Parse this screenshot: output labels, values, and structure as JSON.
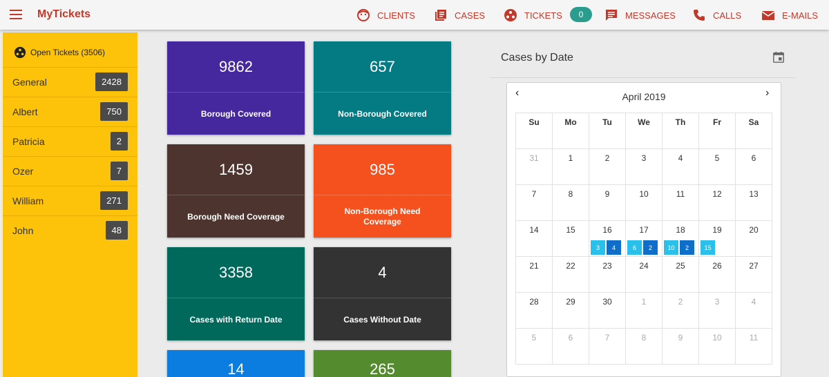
{
  "app": {
    "title": "MyTickets"
  },
  "nav": [
    {
      "label": "CLIENTS",
      "icon": "face-icon"
    },
    {
      "label": "CASES",
      "icon": "library-icon"
    },
    {
      "label": "TICKETS",
      "icon": "tickets-icon"
    },
    {
      "label": "MESSAGES",
      "icon": "message-icon"
    },
    {
      "label": "CALLS",
      "icon": "phone-icon"
    },
    {
      "label": "E-MAILS",
      "icon": "email-icon"
    }
  ],
  "tickets_badge": "0",
  "sidebar": {
    "heading": "Open Tickets (3506)",
    "items": [
      {
        "name": "General",
        "count": "2428"
      },
      {
        "name": "Albert",
        "count": "750"
      },
      {
        "name": "Patricia",
        "count": "2"
      },
      {
        "name": "Ozer",
        "count": "7"
      },
      {
        "name": "William",
        "count": "271"
      },
      {
        "name": "John",
        "count": "48"
      }
    ]
  },
  "cards": [
    {
      "value": "9862",
      "label": "Borough Covered",
      "color": "#45289e"
    },
    {
      "value": "657",
      "label": "Non-Borough Covered",
      "color": "#047b83"
    },
    {
      "value": "1459",
      "label": "Borough Need Coverage",
      "color": "#4e342e"
    },
    {
      "value": "985",
      "label": "Non-Borough Need Coverage",
      "color": "#f4511e"
    },
    {
      "value": "3358",
      "label": "Cases with Return Date",
      "color": "#00695c"
    },
    {
      "value": "4",
      "label": "Cases Without Date",
      "color": "#333333"
    },
    {
      "value": "14",
      "label": "",
      "color": "#0c7de0"
    },
    {
      "value": "265",
      "label": "",
      "color": "#558b2f"
    }
  ],
  "calendar": {
    "title": "Cases by Date",
    "month": "April 2019",
    "weekdays": [
      "Su",
      "Mo",
      "Tu",
      "We",
      "Th",
      "Fr",
      "Sa"
    ],
    "days": [
      {
        "d": "31",
        "dim": true
      },
      {
        "d": "1"
      },
      {
        "d": "2"
      },
      {
        "d": "3"
      },
      {
        "d": "4"
      },
      {
        "d": "5"
      },
      {
        "d": "6"
      },
      {
        "d": "7"
      },
      {
        "d": "8"
      },
      {
        "d": "9"
      },
      {
        "d": "10"
      },
      {
        "d": "11"
      },
      {
        "d": "12"
      },
      {
        "d": "13"
      },
      {
        "d": "14"
      },
      {
        "d": "15"
      },
      {
        "d": "16",
        "chips": [
          {
            "v": "3",
            "t": "light"
          },
          {
            "v": "4",
            "t": "dark"
          }
        ]
      },
      {
        "d": "17",
        "chips": [
          {
            "v": "6",
            "t": "light"
          },
          {
            "v": "2",
            "t": "dark"
          }
        ]
      },
      {
        "d": "18",
        "chips": [
          {
            "v": "10",
            "t": "light"
          },
          {
            "v": "2",
            "t": "dark"
          }
        ]
      },
      {
        "d": "19",
        "chips": [
          {
            "v": "15",
            "t": "light"
          }
        ]
      },
      {
        "d": "20"
      },
      {
        "d": "21"
      },
      {
        "d": "22"
      },
      {
        "d": "23"
      },
      {
        "d": "24"
      },
      {
        "d": "25"
      },
      {
        "d": "26"
      },
      {
        "d": "27"
      },
      {
        "d": "28"
      },
      {
        "d": "29"
      },
      {
        "d": "30"
      },
      {
        "d": "1",
        "dim": true
      },
      {
        "d": "2",
        "dim": true
      },
      {
        "d": "3",
        "dim": true
      },
      {
        "d": "4",
        "dim": true
      },
      {
        "d": "5",
        "dim": true
      },
      {
        "d": "6",
        "dim": true
      },
      {
        "d": "7",
        "dim": true
      },
      {
        "d": "8",
        "dim": true
      },
      {
        "d": "9",
        "dim": true
      },
      {
        "d": "10",
        "dim": true
      },
      {
        "d": "11",
        "dim": true
      }
    ]
  }
}
